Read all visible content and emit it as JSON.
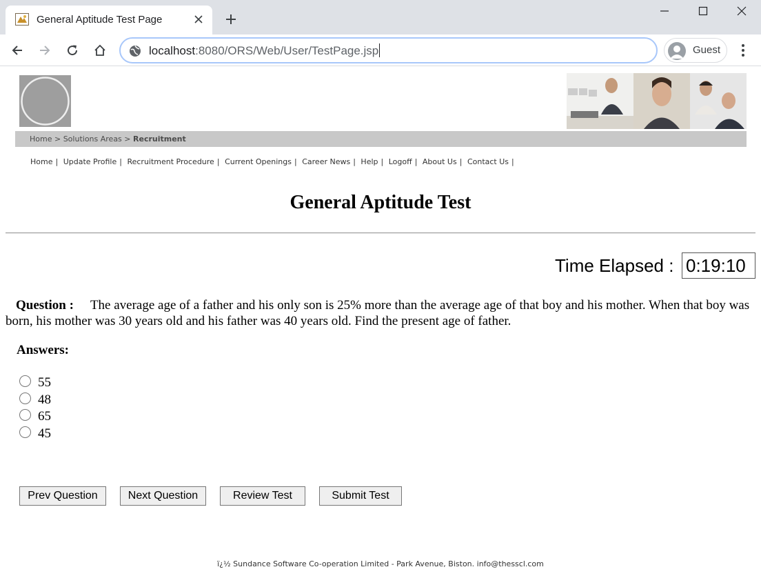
{
  "browser": {
    "tab_title": "General Aptitude Test Page",
    "url_host": "localhost",
    "url_rest": ":8080/ORS/Web/User/TestPage.jsp",
    "profile_name": "Guest"
  },
  "breadcrumb": {
    "home": "Home",
    "sep1": ">",
    "solutions": "Solutions Areas",
    "sep2": ">",
    "current": "Recruitment"
  },
  "nav": {
    "items": [
      "Home",
      "Update Profile",
      "Recruitment Procedure",
      "Current Openings",
      "Career News",
      "Help",
      "Logoff",
      "About Us",
      "Contact Us"
    ],
    "separator": "|"
  },
  "page": {
    "title": "General Aptitude Test",
    "time_label": "Time Elapsed :",
    "time_value": "0:19:10",
    "question_label": "Question :",
    "question_text": "The average age of a father and his only son is 25% more than the average age of that boy and his mother. When that boy was born, his mother was 30 years old and his father was 40 years old. Find the present age of father.",
    "answers_label": "Answers:",
    "options": [
      "55",
      "48",
      "65",
      "45"
    ]
  },
  "buttons": {
    "prev": "Prev Question",
    "next": "Next Question",
    "review": "Review Test",
    "submit": "Submit Test"
  },
  "footer": {
    "text": "ï¿½ Sundance Software Co-operation Limited - Park Avenue, Biston. info@thesscl.com"
  }
}
